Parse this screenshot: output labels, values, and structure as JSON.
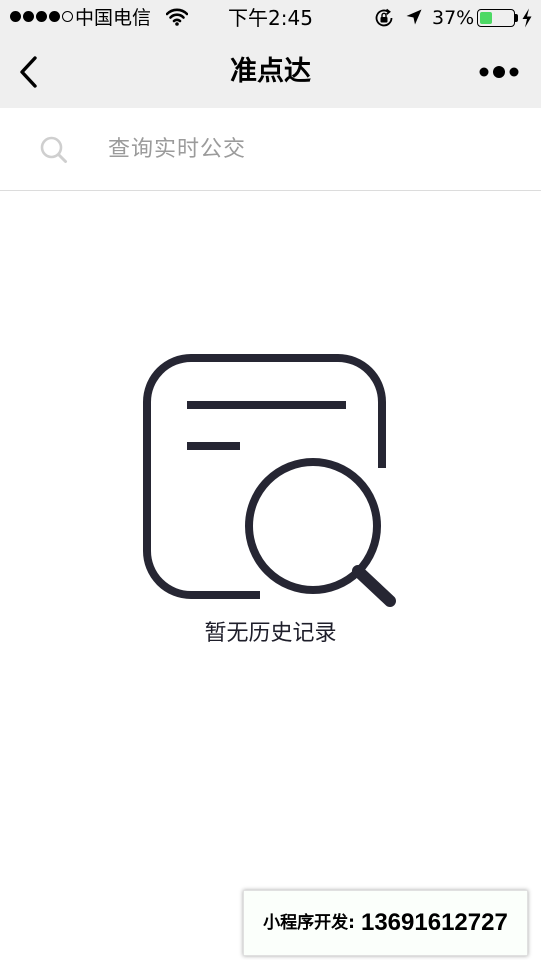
{
  "status_bar": {
    "signal_filled": 4,
    "signal_total": 5,
    "carrier": "中国电信",
    "wifi_icon": "wifi-icon",
    "time": "下午2:45",
    "rotation_lock_icon": "rotation-lock-icon",
    "location_icon": "location-arrow-icon",
    "battery_percent": "37%",
    "battery_level": 0.37,
    "charging_icon": "lightning-icon"
  },
  "nav_bar": {
    "back_icon": "chevron-left-icon",
    "title": "准点达",
    "more_icon": "more-dots-icon"
  },
  "search": {
    "icon": "search-icon",
    "placeholder": "查询实时公交"
  },
  "empty_state": {
    "icon": "search-document-icon",
    "message": "暂无历史记录"
  },
  "dev_badge": {
    "label": "小程序开发:",
    "phone": "13691612727"
  },
  "colors": {
    "nav_background": "#efefef",
    "battery_green": "#4cd964",
    "illustration": "#262633",
    "placeholder_text": "#9b9b9b",
    "search_icon": "#cfcfcf"
  }
}
